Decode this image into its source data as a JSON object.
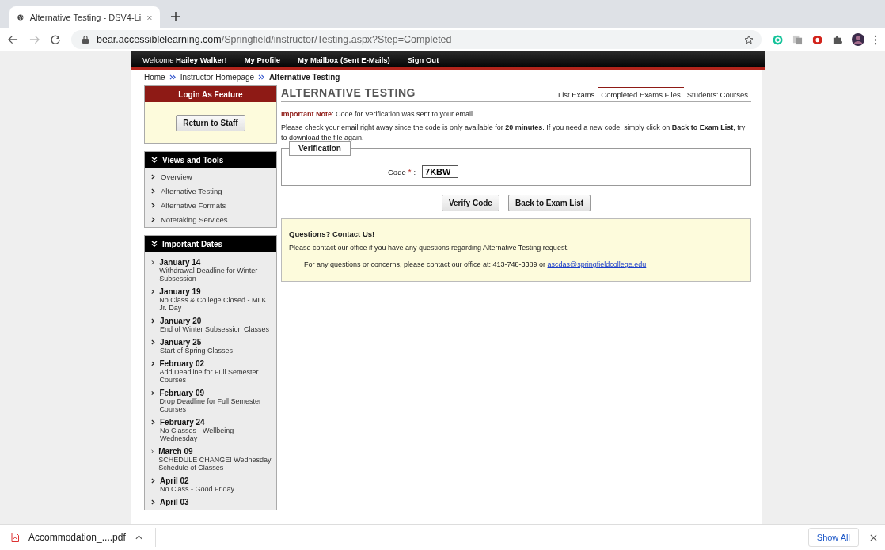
{
  "browser": {
    "tab_title": "Alternative Testing - DSV4-Li",
    "url_host": "bear.accessiblelearning.com",
    "url_path": "/Springfield/instructor/Testing.aspx?Step=Completed"
  },
  "topnav": {
    "welcome": "Welcome **Hailey Walker!**",
    "links": [
      "My Profile",
      "My Mailbox (Sent E-Mails)",
      "Sign Out"
    ]
  },
  "breadcrumb": [
    {
      "label": "Home",
      "current": false
    },
    {
      "label": "Instructor Homepage",
      "current": false
    },
    {
      "label": "Alternative Testing",
      "current": true
    }
  ],
  "sidebar": {
    "login_panel": {
      "title": "Login As Feature",
      "button": "Return to Staff"
    },
    "views": {
      "title": "Views and Tools",
      "items": [
        "Overview",
        "Alternative Testing",
        "Alternative Formats",
        "Notetaking Services"
      ]
    },
    "dates": {
      "title": "Important Dates",
      "items": [
        {
          "date": "January 14",
          "desc": "Withdrawal Deadline for Winter Subsession"
        },
        {
          "date": "January 19",
          "desc": "No Class & College Closed - MLK Jr. Day"
        },
        {
          "date": "January 20",
          "desc": "End of Winter Subsession Classes"
        },
        {
          "date": "January 25",
          "desc": "Start of Spring Classes"
        },
        {
          "date": "February 02",
          "desc": "Add Deadline for Full Semester Courses"
        },
        {
          "date": "February 09",
          "desc": "Drop Deadline for Full Semester Courses"
        },
        {
          "date": "February 24",
          "desc": "No Classes - Wellbeing Wednesday"
        },
        {
          "date": "March 09",
          "desc": "SCHEDULE CHANGE! Wednesday Schedule of Classes"
        },
        {
          "date": "April 02",
          "desc": "No Class - Good Friday"
        },
        {
          "date": "April 03"
        }
      ]
    }
  },
  "main": {
    "title": "ALTERNATIVE TESTING",
    "tabs": [
      {
        "label": "List Exams",
        "selected": false
      },
      {
        "label": "Completed Exams Files",
        "selected": true
      },
      {
        "label": "Students' Courses",
        "selected": false
      }
    ],
    "note": "**Important Note**: Code for Verification was sent to your email.",
    "instructions": "Please check your email right away since the code is only available for **20 minutes**. If you need a new code, simply click on **Back to Exam List**, try to download the file again.",
    "verification": {
      "legend": "Verification",
      "label": "Code",
      "required_mark": "*",
      "colon": ":",
      "value": "7KBW"
    },
    "buttons": [
      "Verify Code",
      "Back to Exam List"
    ],
    "contact": {
      "title": "Questions? Contact Us!",
      "text": "Please contact our office if you have any questions regarding Alternative Testing request.",
      "line": "For any questions or concerns, please contact our office at: 413-748-3389 or ",
      "email": "ascdas@springfieldcollege.edu"
    }
  },
  "downloads": {
    "file": "Accommodation_....pdf",
    "show_all": "Show All"
  }
}
